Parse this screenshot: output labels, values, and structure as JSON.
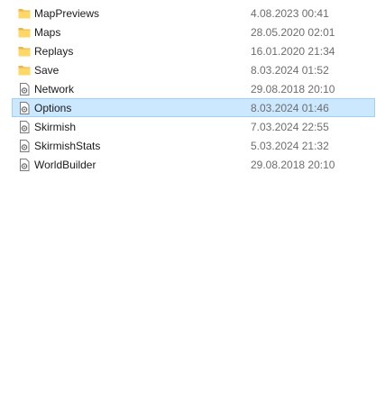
{
  "colors": {
    "folder": "#ffd766",
    "folder_dark": "#e8b64a",
    "selection_bg": "#cce8ff",
    "selection_border": "#99d1ff",
    "date_text": "#6d6d6d"
  },
  "files": [
    {
      "name": "MapPreviews",
      "modified": "4.08.2023 00:41",
      "type": "folder",
      "icon": "folder-icon",
      "selected": false
    },
    {
      "name": "Maps",
      "modified": "28.05.2020 02:01",
      "type": "folder",
      "icon": "folder-icon",
      "selected": false
    },
    {
      "name": "Replays",
      "modified": "16.01.2020 21:34",
      "type": "folder",
      "icon": "folder-icon",
      "selected": false
    },
    {
      "name": "Save",
      "modified": "8.03.2024 01:52",
      "type": "folder",
      "icon": "folder-icon",
      "selected": false
    },
    {
      "name": "Network",
      "modified": "29.08.2018 20:10",
      "type": "file",
      "icon": "settings-file-icon",
      "selected": false
    },
    {
      "name": "Options",
      "modified": "8.03.2024 01:46",
      "type": "file",
      "icon": "settings-file-icon",
      "selected": true
    },
    {
      "name": "Skirmish",
      "modified": "7.03.2024 22:55",
      "type": "file",
      "icon": "settings-file-icon",
      "selected": false
    },
    {
      "name": "SkirmishStats",
      "modified": "5.03.2024 21:32",
      "type": "file",
      "icon": "settings-file-icon",
      "selected": false
    },
    {
      "name": "WorldBuilder",
      "modified": "29.08.2018 20:10",
      "type": "file",
      "icon": "settings-file-icon",
      "selected": false
    }
  ]
}
